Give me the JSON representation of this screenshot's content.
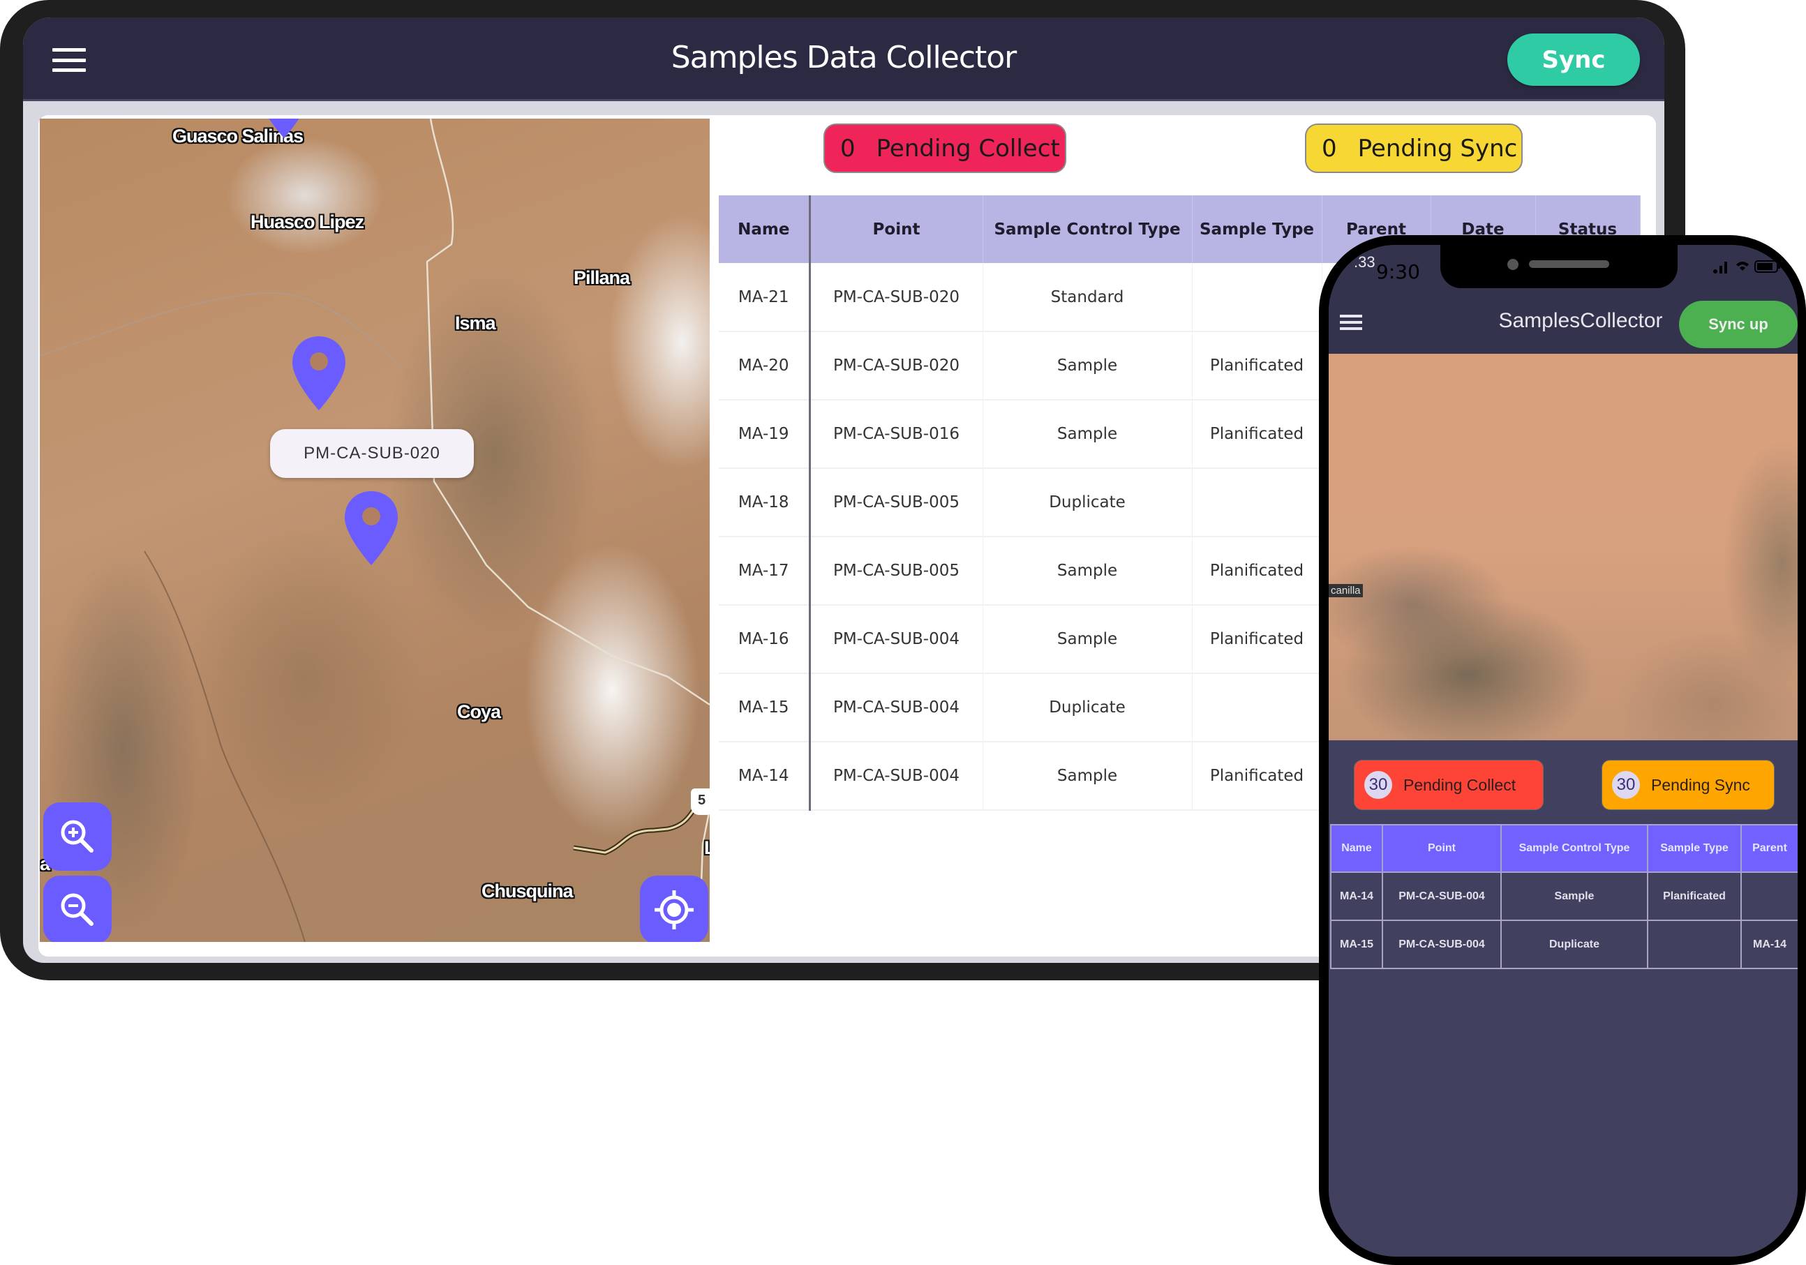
{
  "tablet": {
    "app_title": "Samples Data Collector",
    "sync_button": "Sync",
    "menu_icon": "hamburger-menu-icon",
    "pending_collect": {
      "count": "0",
      "label": "Pending Collect",
      "color": "#ef2458"
    },
    "pending_sync": {
      "count": "0",
      "label": "Pending Sync",
      "color": "#f7d733"
    },
    "map": {
      "places": [
        "Guasco Salinas",
        "Huasco Lipez",
        "Pillana",
        "Isma",
        "Coya",
        "Chusquina",
        "a",
        "L"
      ],
      "highway_shield": "5",
      "marker_popup": "PM-CA-SUB-020",
      "marker_color": "#6a5cff",
      "controls": {
        "zoom_in_icon": "zoom-in-icon",
        "zoom_out_icon": "zoom-out-icon",
        "locate_icon": "my-location-icon"
      }
    },
    "table": {
      "columns": [
        "Name",
        "Point",
        "Sample Control Type",
        "Sample Type",
        "Parent",
        "Date",
        "Status"
      ],
      "rows": [
        {
          "name": "MA-21",
          "point": "PM-CA-SUB-020",
          "control_type": "Standard",
          "sample_type": "",
          "parent": "",
          "date": "",
          "status": ""
        },
        {
          "name": "MA-20",
          "point": "PM-CA-SUB-020",
          "control_type": "Sample",
          "sample_type": "Planificated",
          "parent": "",
          "date": "",
          "status": ""
        },
        {
          "name": "MA-19",
          "point": "PM-CA-SUB-016",
          "control_type": "Sample",
          "sample_type": "Planificated",
          "parent": "",
          "date": "",
          "status": ""
        },
        {
          "name": "MA-18",
          "point": "PM-CA-SUB-005",
          "control_type": "Duplicate",
          "sample_type": "",
          "parent": "",
          "date": "",
          "status": ""
        },
        {
          "name": "MA-17",
          "point": "PM-CA-SUB-005",
          "control_type": "Sample",
          "sample_type": "Planificated",
          "parent": "",
          "date": "",
          "status": ""
        },
        {
          "name": "MA-16",
          "point": "PM-CA-SUB-004",
          "control_type": "Sample",
          "sample_type": "Planificated",
          "parent": "",
          "date": "",
          "status": ""
        },
        {
          "name": "MA-15",
          "point": "PM-CA-SUB-004",
          "control_type": "Duplicate",
          "sample_type": "",
          "parent": "",
          "date": "",
          "status": ""
        },
        {
          "name": "MA-14",
          "point": "PM-CA-SUB-004",
          "control_type": "Sample",
          "sample_type": "Planificated",
          "parent": "",
          "date": "",
          "status": ""
        }
      ]
    }
  },
  "phone": {
    "status_bar": {
      "time_ghost": ".33",
      "time": "9:30"
    },
    "app_title": "SamplesCollector",
    "sync_button": "Sync up",
    "map_place": "canilla",
    "pending_collect": {
      "count": "30",
      "label": "Pending Collect",
      "color": "#fe4436"
    },
    "pending_sync": {
      "count": "30",
      "label": "Pending Sync",
      "color": "#ffa500"
    },
    "table": {
      "columns": [
        "Name",
        "Point",
        "Sample Control Type",
        "Sample Type",
        "Parent"
      ],
      "rows": [
        {
          "name": "MA-14",
          "point": "PM-CA-SUB-004",
          "control_type": "Sample",
          "sample_type": "Planificated",
          "parent": ""
        },
        {
          "name": "MA-15",
          "point": "PM-CA-SUB-004",
          "control_type": "Duplicate",
          "sample_type": "",
          "parent": "MA-14"
        }
      ]
    }
  }
}
